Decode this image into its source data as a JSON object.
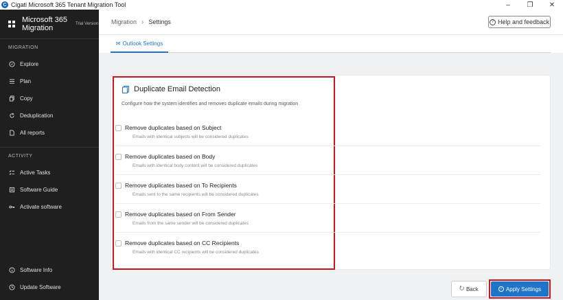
{
  "window": {
    "title": "Cigati Microsoft 365 Tenant Migration Tool",
    "minimize": "–",
    "maximize": "❐",
    "close": "✕"
  },
  "sidebar": {
    "brand_name": "Microsoft 365 Migration",
    "trial_badge": "Trial Version",
    "sections": [
      {
        "label": "MIGRATION",
        "items": [
          {
            "label": "Explore",
            "icon": "compass-icon"
          },
          {
            "label": "Plan",
            "icon": "list-icon"
          },
          {
            "label": "Copy",
            "icon": "copy-icon"
          },
          {
            "label": "Deduplication",
            "icon": "refresh-icon"
          },
          {
            "label": "All reports",
            "icon": "document-icon"
          }
        ]
      },
      {
        "label": "ACTIVITY",
        "items": [
          {
            "label": "Active Tasks",
            "icon": "checklist-icon"
          },
          {
            "label": "Software Guide",
            "icon": "book-icon"
          },
          {
            "label": "Activate software",
            "icon": "key-icon"
          }
        ]
      }
    ],
    "bottom_items": [
      {
        "label": "Software Info",
        "icon": "info-icon"
      },
      {
        "label": "Update Software",
        "icon": "clock-icon"
      }
    ]
  },
  "breadcrumb": {
    "root": "Migration",
    "separator": "›",
    "current": "Settings"
  },
  "help_button": "Help and feedback",
  "tab": {
    "label": "Outlook Settings"
  },
  "section": {
    "title": "Duplicate Email Detection",
    "description": "Configure how the system identifies and removes duplicate emails during migration"
  },
  "options": [
    {
      "label": "Remove duplicates based on Subject",
      "sub": "Emails with identical subjects will be considered duplicates",
      "checked": false
    },
    {
      "label": "Remove duplicates based on Body",
      "sub": "Emails with identical body content will be considered duplicates",
      "checked": false
    },
    {
      "label": "Remove duplicates based on To Recipients",
      "sub": "Emails sent to the same recipients will be considered duplicates",
      "checked": false
    },
    {
      "label": "Remove duplicates based on From Sender",
      "sub": "Emails from the same sender will be considered duplicates",
      "checked": false
    },
    {
      "label": "Remove duplicates based on CC Recipients",
      "sub": "Emails with identical CC recipients will be considered duplicates",
      "checked": false
    }
  ],
  "buttons": {
    "back": "Back",
    "apply": "Apply Settings"
  },
  "colors": {
    "accent": "#1e74c9",
    "highlight": "#c8151b",
    "sidebar_bg": "#1f1f1f"
  }
}
